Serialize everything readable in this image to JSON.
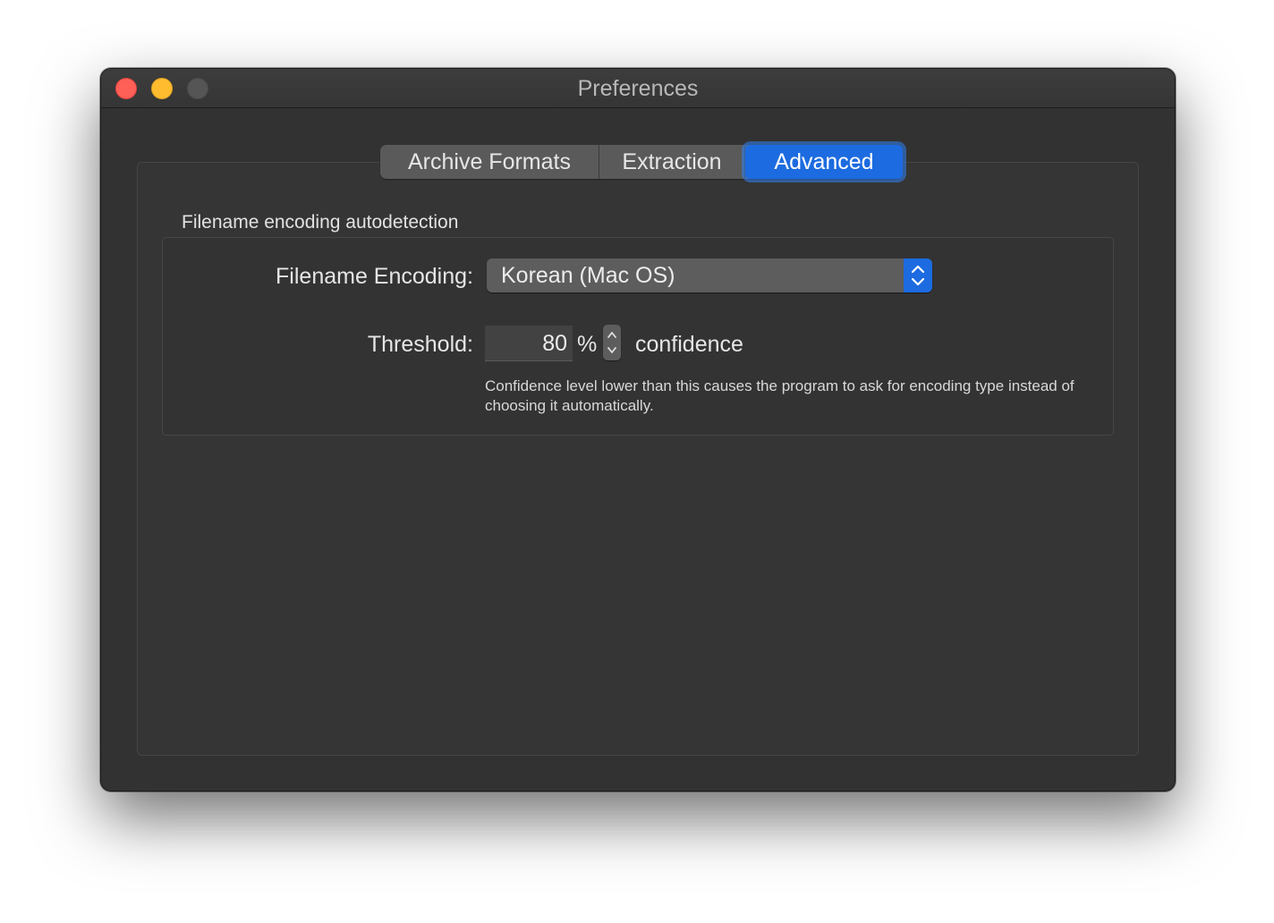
{
  "window": {
    "title": "Preferences"
  },
  "tabs": [
    {
      "label": "Archive Formats",
      "selected": false
    },
    {
      "label": "Extraction",
      "selected": false
    },
    {
      "label": "Advanced",
      "selected": true
    }
  ],
  "section": {
    "title": "Filename encoding autodetection"
  },
  "encoding": {
    "label": "Filename Encoding:",
    "value": "Korean (Mac OS)"
  },
  "threshold": {
    "label": "Threshold:",
    "value": "80",
    "unit": "%",
    "suffix": "confidence",
    "help": "Confidence level lower than this causes the program to ask for encoding type instead of choosing it automatically."
  },
  "icons": {
    "close": "close-button-icon",
    "minimize": "minimize-button-icon",
    "zoom": "zoom-button-icon",
    "select_arrows": "chevron-up-down-icon",
    "stepper": "stepper-arrows-icon"
  },
  "colors": {
    "accent": "#1c6be0",
    "window_bg": "#323232",
    "close": "#fe5f57",
    "minimize": "#febc2e",
    "zoom_disabled": "#555555"
  }
}
